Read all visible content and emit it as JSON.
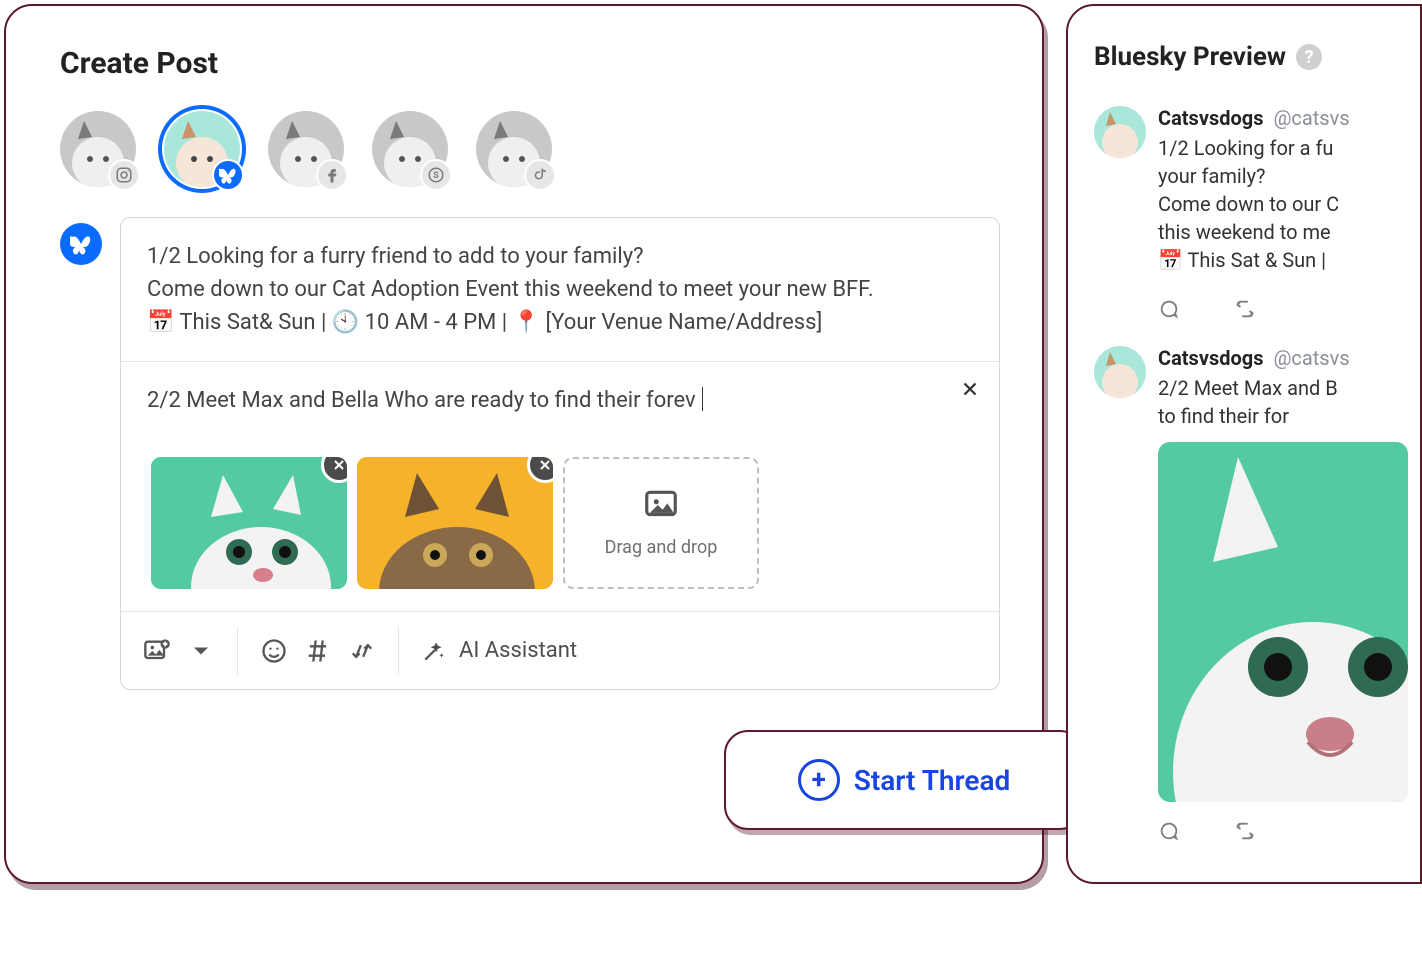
{
  "create": {
    "title": "Create Post",
    "accounts": [
      {
        "network": "instagram",
        "active": false
      },
      {
        "network": "bluesky",
        "active": true
      },
      {
        "network": "facebook",
        "active": false
      },
      {
        "network": "threads",
        "active": false
      },
      {
        "network": "tiktok",
        "active": false
      }
    ],
    "segments": [
      {
        "text_line1": "1/2 Looking for a furry friend to add to your family?",
        "text_line2": "Come down to our Cat Adoption Event this weekend to meet your new BFF.",
        "text_line3": "📅 This Sat& Sun  |  🕙 10 AM - 4 PM  |  📍 [Your Venue Name/Address]"
      },
      {
        "text": "2/2 Meet Max and Bella Who are ready to find their forev"
      }
    ],
    "media": [
      {
        "id": "cat-white",
        "alt": "white cat on teal",
        "color": "#53c9a4"
      },
      {
        "id": "cat-tabby",
        "alt": "tabby cat on yellow",
        "color": "#f6b22a"
      }
    ],
    "dropzone_text": "Drag and drop",
    "toolbar": {
      "ai_label": "AI Assistant"
    },
    "start_thread_label": "Start Thread"
  },
  "preview": {
    "title": "Bluesky Preview",
    "posts": [
      {
        "name": "Catsvsdogs",
        "handle": "@catsvs",
        "line1": "1/2 Looking for a fu",
        "line2": "your family?",
        "line3": "Come down to our C",
        "line4": "this weekend to me",
        "line5": "📅 This Sat & Sun  |"
      },
      {
        "name": "Catsvsdogs",
        "handle": "@catsvs",
        "line1": "2/2 Meet Max and B",
        "line2": "to find their for"
      }
    ]
  }
}
